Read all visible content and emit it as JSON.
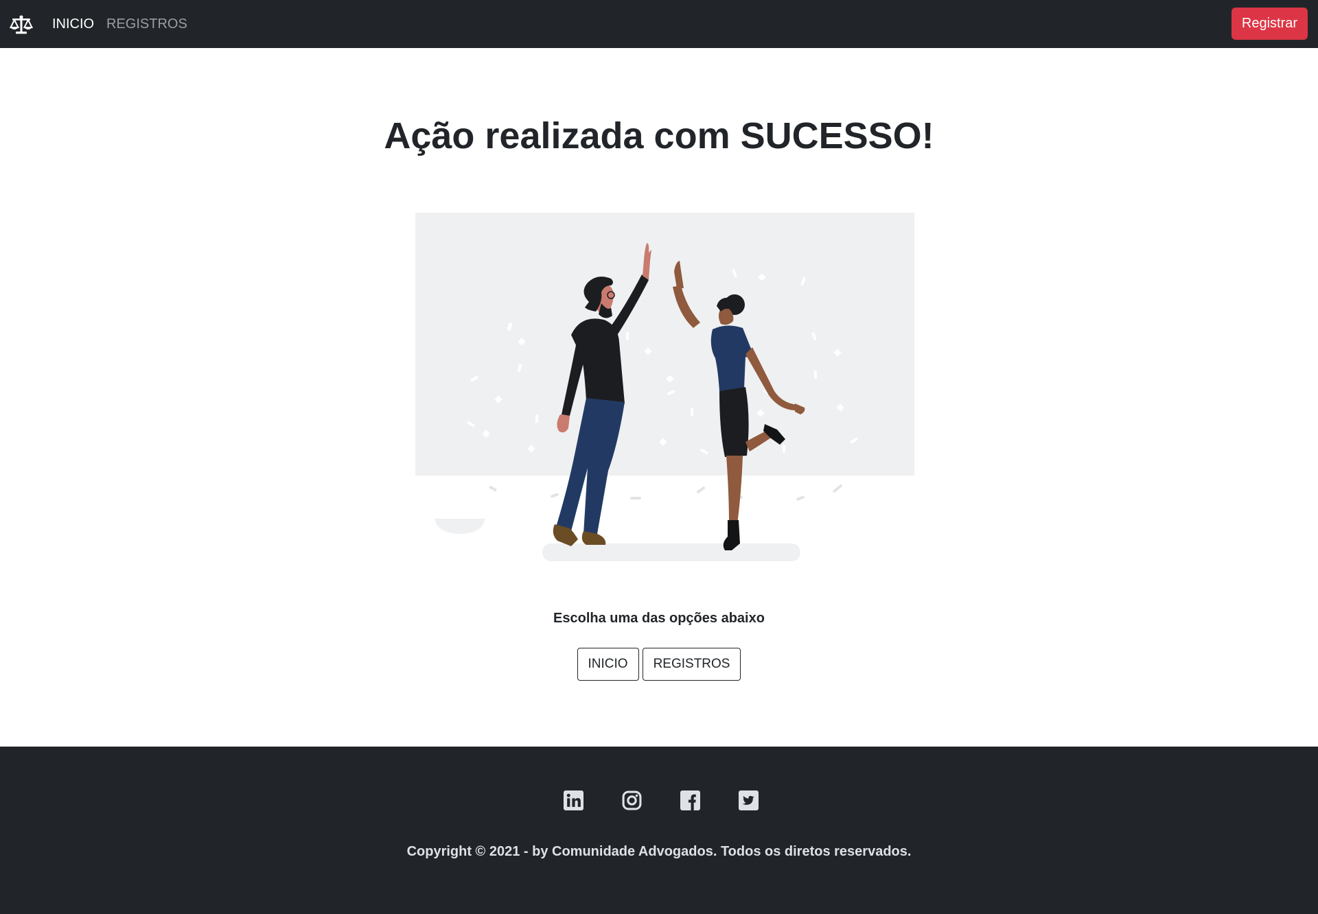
{
  "navbar": {
    "brand_icon": "scales-of-justice-icon",
    "links": [
      "INICIO",
      "REGISTROS"
    ],
    "register_button": "Registrar",
    "bg_color": "#212529",
    "accent_color": "#dc3545"
  },
  "main": {
    "title": "Ação realizada com SUCESSO!",
    "illustration": "high-five-celebration-illustration",
    "subtitle": "Escolha uma das opções abaixo",
    "buttons": [
      "INICIO",
      "REGISTROS"
    ]
  },
  "footer": {
    "social_icons": [
      "linkedin-icon",
      "instagram-icon",
      "facebook-icon",
      "twitter-icon"
    ],
    "copyright": "Copyright © 2021 - by Comunidade Advogados. Todos os diretos reservados."
  }
}
